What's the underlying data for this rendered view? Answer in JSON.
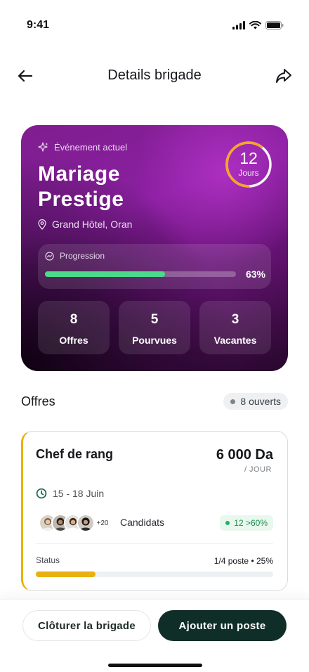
{
  "status_bar": {
    "time": "9:41"
  },
  "header": {
    "title": "Details brigade"
  },
  "event": {
    "tag": "Événement actuel",
    "title": "Mariage Prestige",
    "location": "Grand Hôtel, Oran",
    "days_value": "12",
    "days_label": "Jours",
    "days_ring_fraction": 0.6,
    "progress_label": "Progression",
    "progress_percent": 63,
    "progress_text": "63%",
    "stats": [
      {
        "value": "8",
        "label": "Offres"
      },
      {
        "value": "5",
        "label": "Pourvues"
      },
      {
        "value": "3",
        "label": "Vacantes"
      }
    ]
  },
  "offers_section": {
    "title": "Offres",
    "open_badge": "8 ouverts"
  },
  "offer": {
    "title": "Chef de rang",
    "price": "6 000 Da",
    "unit": "/ JOUR",
    "dates": "15 - 18 Juin",
    "more_candidates": "+20",
    "candidates_label": "Candidats",
    "score_badge": "12 >60%",
    "status_label": "Status",
    "status_value": "1/4 poste • 25%",
    "status_percent": 25
  },
  "actions": {
    "close_label": "Clôturer la brigade",
    "add_label": "Ajouter un poste"
  },
  "colors": {
    "accent_green": "#4bd98a",
    "ring_orange": "#f5a623",
    "status_yellow": "#e9b10f",
    "primary_dark": "#0f2e28"
  }
}
